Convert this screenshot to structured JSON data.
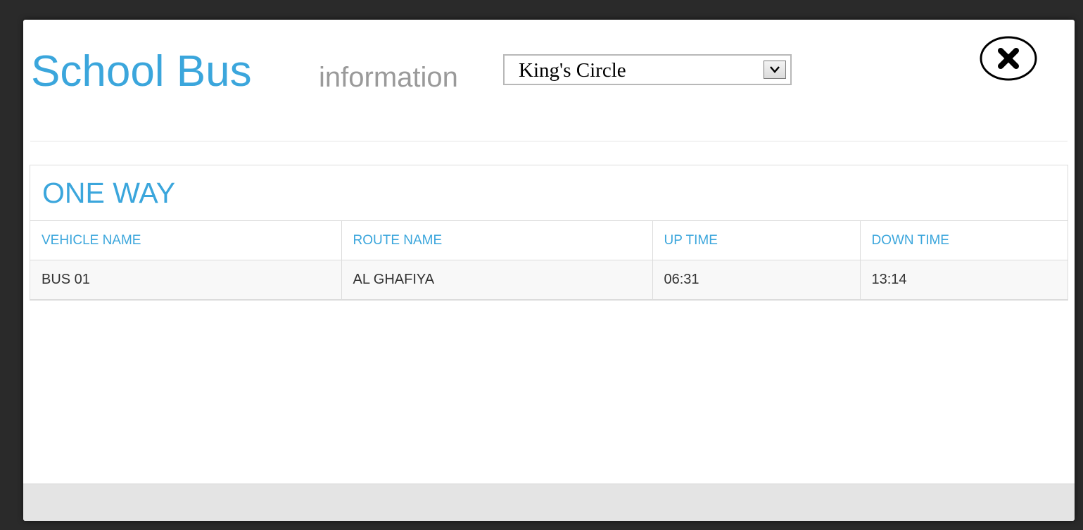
{
  "modal": {
    "title_main": "School Bus",
    "title_sub": "information",
    "location_select": {
      "selected": "King's Circle"
    },
    "close_icon": "close-circle-x-icon"
  },
  "panel": {
    "title": "ONE WAY",
    "columns": [
      "VEHICLE NAME",
      "ROUTE NAME",
      "UP TIME",
      "DOWN TIME"
    ],
    "rows": [
      [
        "BUS 01",
        "AL GHAFIYA",
        "06:31",
        "13:14"
      ]
    ]
  },
  "colors": {
    "accent": "#3ba6dc",
    "subtitle": "#9a9a9a",
    "footer": "#e4e4e4"
  }
}
